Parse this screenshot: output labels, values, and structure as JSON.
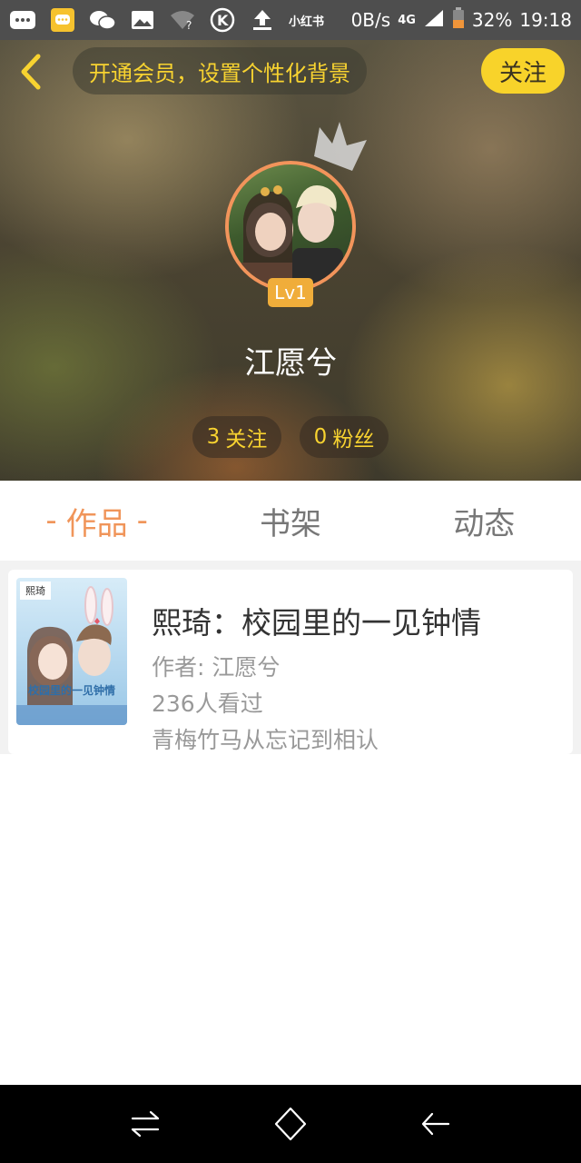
{
  "status_bar": {
    "app_icons": [
      "message-icon",
      "chat-bubble-icon",
      "wechat-icon",
      "image-icon",
      "wifi-icon",
      "k-icon",
      "upload-icon"
    ],
    "app_label": "小红书",
    "network_speed": "0B/s",
    "network_type": "4G",
    "battery": "32%",
    "time": "19:18"
  },
  "header": {
    "back_icon": "chevron-left-icon",
    "vip_prompt": "开通会员，设置个性化背景",
    "follow_label": "关注",
    "level": "Lv1",
    "username": "江愿兮",
    "following_count": "3",
    "following_label": "关注",
    "fans_count": "0",
    "fans_label": "粉丝"
  },
  "tabs": [
    {
      "label": "作品",
      "active": true
    },
    {
      "label": "书架",
      "active": false
    },
    {
      "label": "动态",
      "active": false
    }
  ],
  "works": [
    {
      "cover_tag": "熙琦",
      "cover_text": "校园里的一见钟情",
      "title": "熙琦：校园里的一见钟情",
      "author": "作者: 江愿兮",
      "views": "236人看过",
      "description": "青梅竹马从忘记到相认"
    }
  ],
  "navbar": {
    "icons": [
      "switch-icon",
      "home-icon",
      "back-icon"
    ]
  },
  "colors": {
    "accent_orange": "#f0955a",
    "accent_yellow": "#f8d330",
    "follow_button": "#f8d32a",
    "level_badge": "#f0ad3a"
  }
}
